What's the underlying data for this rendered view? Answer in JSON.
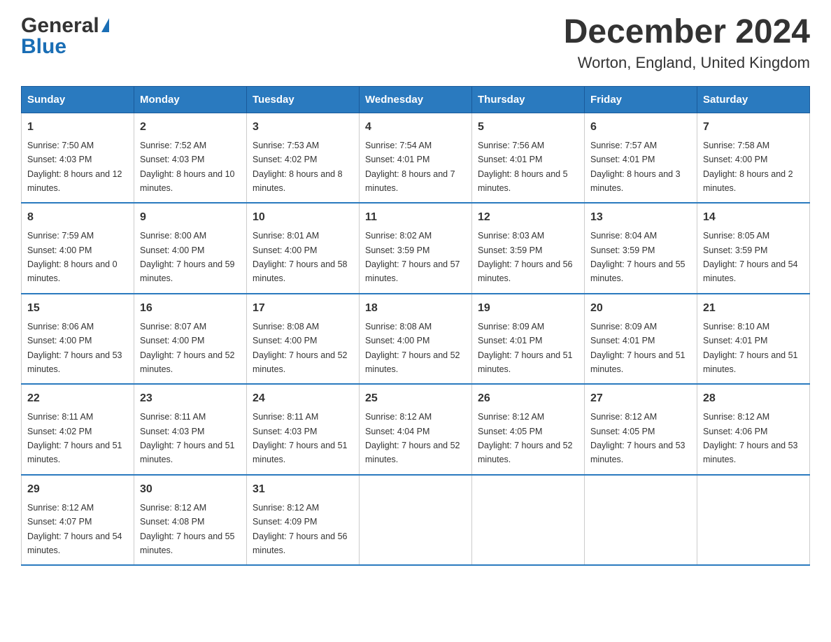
{
  "header": {
    "logo_general": "General",
    "logo_blue": "Blue",
    "title": "December 2024",
    "subtitle": "Worton, England, United Kingdom"
  },
  "days_of_week": [
    "Sunday",
    "Monday",
    "Tuesday",
    "Wednesday",
    "Thursday",
    "Friday",
    "Saturday"
  ],
  "weeks": [
    [
      {
        "day": "1",
        "sunrise": "7:50 AM",
        "sunset": "4:03 PM",
        "daylight": "8 hours and 12 minutes."
      },
      {
        "day": "2",
        "sunrise": "7:52 AM",
        "sunset": "4:03 PM",
        "daylight": "8 hours and 10 minutes."
      },
      {
        "day": "3",
        "sunrise": "7:53 AM",
        "sunset": "4:02 PM",
        "daylight": "8 hours and 8 minutes."
      },
      {
        "day": "4",
        "sunrise": "7:54 AM",
        "sunset": "4:01 PM",
        "daylight": "8 hours and 7 minutes."
      },
      {
        "day": "5",
        "sunrise": "7:56 AM",
        "sunset": "4:01 PM",
        "daylight": "8 hours and 5 minutes."
      },
      {
        "day": "6",
        "sunrise": "7:57 AM",
        "sunset": "4:01 PM",
        "daylight": "8 hours and 3 minutes."
      },
      {
        "day": "7",
        "sunrise": "7:58 AM",
        "sunset": "4:00 PM",
        "daylight": "8 hours and 2 minutes."
      }
    ],
    [
      {
        "day": "8",
        "sunrise": "7:59 AM",
        "sunset": "4:00 PM",
        "daylight": "8 hours and 0 minutes."
      },
      {
        "day": "9",
        "sunrise": "8:00 AM",
        "sunset": "4:00 PM",
        "daylight": "7 hours and 59 minutes."
      },
      {
        "day": "10",
        "sunrise": "8:01 AM",
        "sunset": "4:00 PM",
        "daylight": "7 hours and 58 minutes."
      },
      {
        "day": "11",
        "sunrise": "8:02 AM",
        "sunset": "3:59 PM",
        "daylight": "7 hours and 57 minutes."
      },
      {
        "day": "12",
        "sunrise": "8:03 AM",
        "sunset": "3:59 PM",
        "daylight": "7 hours and 56 minutes."
      },
      {
        "day": "13",
        "sunrise": "8:04 AM",
        "sunset": "3:59 PM",
        "daylight": "7 hours and 55 minutes."
      },
      {
        "day": "14",
        "sunrise": "8:05 AM",
        "sunset": "3:59 PM",
        "daylight": "7 hours and 54 minutes."
      }
    ],
    [
      {
        "day": "15",
        "sunrise": "8:06 AM",
        "sunset": "4:00 PM",
        "daylight": "7 hours and 53 minutes."
      },
      {
        "day": "16",
        "sunrise": "8:07 AM",
        "sunset": "4:00 PM",
        "daylight": "7 hours and 52 minutes."
      },
      {
        "day": "17",
        "sunrise": "8:08 AM",
        "sunset": "4:00 PM",
        "daylight": "7 hours and 52 minutes."
      },
      {
        "day": "18",
        "sunrise": "8:08 AM",
        "sunset": "4:00 PM",
        "daylight": "7 hours and 52 minutes."
      },
      {
        "day": "19",
        "sunrise": "8:09 AM",
        "sunset": "4:01 PM",
        "daylight": "7 hours and 51 minutes."
      },
      {
        "day": "20",
        "sunrise": "8:09 AM",
        "sunset": "4:01 PM",
        "daylight": "7 hours and 51 minutes."
      },
      {
        "day": "21",
        "sunrise": "8:10 AM",
        "sunset": "4:01 PM",
        "daylight": "7 hours and 51 minutes."
      }
    ],
    [
      {
        "day": "22",
        "sunrise": "8:11 AM",
        "sunset": "4:02 PM",
        "daylight": "7 hours and 51 minutes."
      },
      {
        "day": "23",
        "sunrise": "8:11 AM",
        "sunset": "4:03 PM",
        "daylight": "7 hours and 51 minutes."
      },
      {
        "day": "24",
        "sunrise": "8:11 AM",
        "sunset": "4:03 PM",
        "daylight": "7 hours and 51 minutes."
      },
      {
        "day": "25",
        "sunrise": "8:12 AM",
        "sunset": "4:04 PM",
        "daylight": "7 hours and 52 minutes."
      },
      {
        "day": "26",
        "sunrise": "8:12 AM",
        "sunset": "4:05 PM",
        "daylight": "7 hours and 52 minutes."
      },
      {
        "day": "27",
        "sunrise": "8:12 AM",
        "sunset": "4:05 PM",
        "daylight": "7 hours and 53 minutes."
      },
      {
        "day": "28",
        "sunrise": "8:12 AM",
        "sunset": "4:06 PM",
        "daylight": "7 hours and 53 minutes."
      }
    ],
    [
      {
        "day": "29",
        "sunrise": "8:12 AM",
        "sunset": "4:07 PM",
        "daylight": "7 hours and 54 minutes."
      },
      {
        "day": "30",
        "sunrise": "8:12 AM",
        "sunset": "4:08 PM",
        "daylight": "7 hours and 55 minutes."
      },
      {
        "day": "31",
        "sunrise": "8:12 AM",
        "sunset": "4:09 PM",
        "daylight": "7 hours and 56 minutes."
      },
      null,
      null,
      null,
      null
    ]
  ]
}
